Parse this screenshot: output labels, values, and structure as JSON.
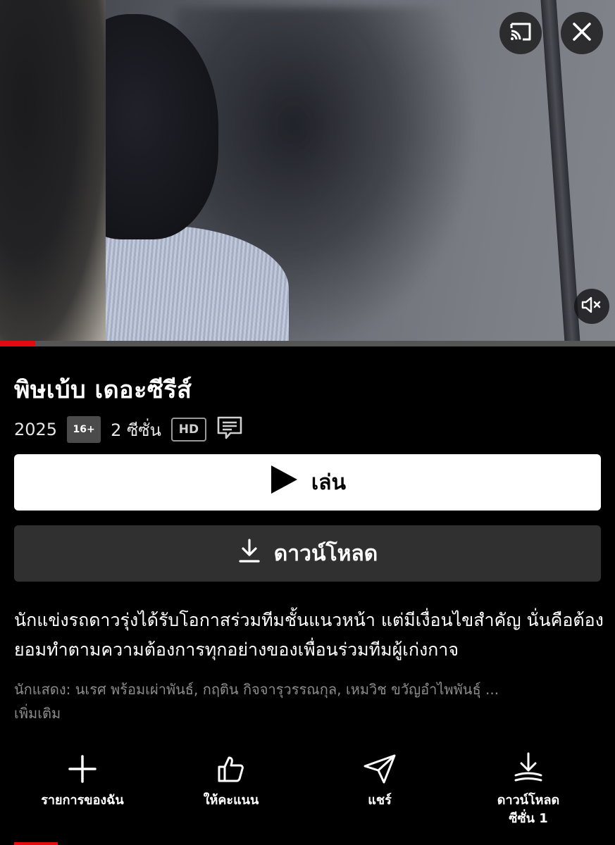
{
  "show": {
    "title": "พิษเบ้บ เดอะซีรีส์",
    "year": "2025",
    "rating": "16+",
    "seasons": "2 ซีซั่น",
    "quality": "HD",
    "subtitle_icon": "subtitles-icon",
    "playback_progress": 0.057
  },
  "buttons": {
    "play_label": "เล่น",
    "download_label": "ดาวน์โหลด"
  },
  "synopsis": "นักแข่งรถดาวรุ่งได้รับโอกาสร่วมทีมชั้นแนวหน้า แต่มีเงื่อนไขสำคัญ นั่นคือต้องยอมทำตามความต้องการทุกอย่างของเพื่อนร่วมทีมผู้เก่งกาจ",
  "cast": {
    "text": "นักแสดง: นเรศ พร้อมเผ่าพันธ์, กฤติน กิจจารุวรรณกุล, เหมวิช ขวัญอำไพพันธุ์ ...",
    "more": "เพิ่มเติม"
  },
  "actions": [
    {
      "label": "รายการของฉัน",
      "icon": "plus-icon"
    },
    {
      "label": "ให้คะแนน",
      "icon": "thumbs-up-icon"
    },
    {
      "label": "แชร์",
      "icon": "send-icon"
    },
    {
      "label": "ดาวน์โหลด",
      "label2": "ซีซั่น 1",
      "icon": "download-season-icon"
    }
  ],
  "icons": {
    "cast": "cast-icon",
    "close": "close-icon",
    "mute": "volume-muted-icon"
  },
  "colors": {
    "accent": "#e50914",
    "background": "#000000",
    "secondary_button": "#303030",
    "muted_text": "#8c8c8c"
  }
}
